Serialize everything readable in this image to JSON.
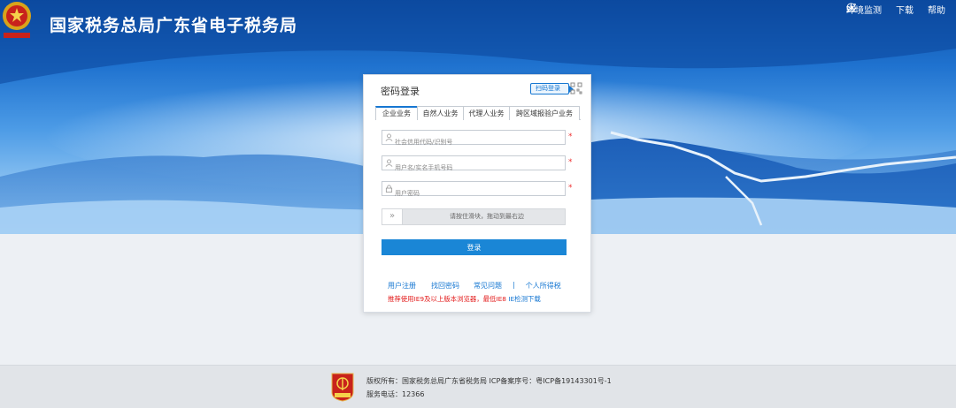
{
  "header": {
    "title": "国家税务总局广东省电子税务局",
    "logo_text": "中国税务",
    "links": [
      {
        "label": "环境监测",
        "icon": "tool-icon"
      },
      {
        "label": "下载",
        "icon": "download-icon"
      },
      {
        "label": "帮助",
        "icon": "help-icon"
      }
    ]
  },
  "login": {
    "title": "密码登录",
    "qr_tag": "扫码登录",
    "tabs": [
      "企业业务",
      "自然人业务",
      "代理人业务",
      "跨区域报验户业务"
    ],
    "active_tab": 0,
    "fields": [
      {
        "placeholder": "社会信用代码/识别号",
        "icon": "user-icon"
      },
      {
        "placeholder": "用户名/实名手机号码",
        "icon": "user-icon"
      },
      {
        "placeholder": "用户密码",
        "icon": "lock-icon"
      }
    ],
    "required_mark": "*",
    "slider_text": "请按住滑块，拖动到最右边",
    "slider_handle": "»",
    "submit": "登录",
    "links": [
      "用户注册",
      "找回密码",
      "常见问题",
      "|",
      "个人所得税"
    ],
    "note_red": "推荐使用IE9及以上版本浏览器，最低IE8",
    "note_blue": "IE检测下载"
  },
  "footer": {
    "line1": "版权所有：国家税务总局广东省税务局    ICP备案序号：粤ICP备19143301号-1",
    "line2": "服务电话：12366",
    "logo_text": "党政机关"
  },
  "colors": {
    "primary": "#1a86d6",
    "required": "#e33333",
    "link": "#1677d2"
  }
}
